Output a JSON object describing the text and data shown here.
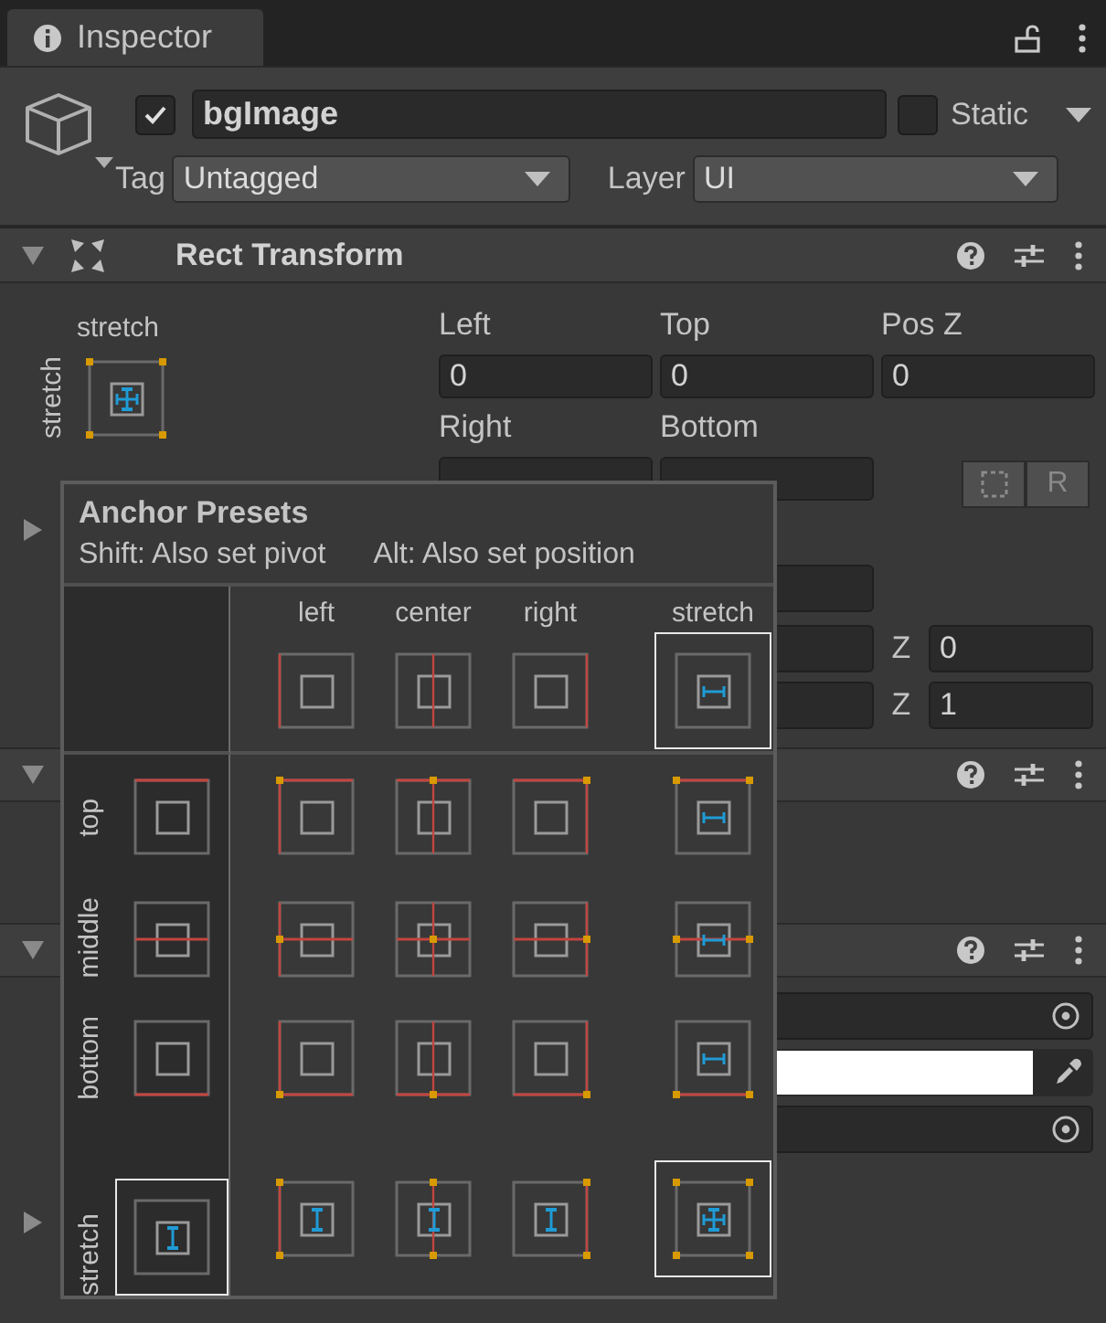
{
  "tab": {
    "title": "Inspector"
  },
  "game_object": {
    "active": true,
    "name": "bgImage",
    "static": false,
    "static_label": "Static",
    "tag_label": "Tag",
    "tag": "Untagged",
    "layer_label": "Layer",
    "layer": "UI"
  },
  "rect_transform": {
    "title": "Rect Transform",
    "expanded": true,
    "anchor": {
      "h_label": "stretch",
      "v_label": "stretch"
    },
    "fields": [
      {
        "label": "Left",
        "value": "0"
      },
      {
        "label": "Top",
        "value": "0"
      },
      {
        "label": "Pos Z",
        "value": "0"
      },
      {
        "label": "Right"
      },
      {
        "label": "Bottom"
      }
    ],
    "raw_button": "R",
    "anchors_expanded": false,
    "z_fields": [
      {
        "label": "Z",
        "value": "0"
      },
      {
        "label": "Z",
        "value": "1"
      }
    ]
  },
  "components": [
    {
      "expanded": true
    },
    {
      "expanded": true,
      "foldout_expanded": false,
      "fields": [
        {
          "kind": "object"
        },
        {
          "kind": "color",
          "color": "#ffffff"
        },
        {
          "kind": "object"
        }
      ]
    }
  ],
  "anchor_presets": {
    "title": "Anchor Presets",
    "shift_hint": "Shift: Also set pivot",
    "alt_hint": "Alt: Also set position",
    "columns": [
      {
        "label": "left",
        "selected": false
      },
      {
        "label": "center",
        "selected": false
      },
      {
        "label": "right",
        "selected": false
      },
      {
        "label": "stretch",
        "selected": true
      }
    ],
    "rows": [
      {
        "label": "top",
        "selected": false,
        "cells": [
          {
            "selected": false
          },
          {
            "selected": false
          },
          {
            "selected": false
          },
          {
            "selected": false
          }
        ]
      },
      {
        "label": "middle",
        "selected": false,
        "cells": [
          {
            "selected": false
          },
          {
            "selected": false
          },
          {
            "selected": false
          },
          {
            "selected": false
          }
        ]
      },
      {
        "label": "bottom",
        "selected": false,
        "cells": [
          {
            "selected": false
          },
          {
            "selected": false
          },
          {
            "selected": false
          },
          {
            "selected": false
          }
        ]
      },
      {
        "label": "stretch",
        "selected": true,
        "cells": [
          {
            "selected": false
          },
          {
            "selected": false
          },
          {
            "selected": false
          },
          {
            "selected": true
          }
        ]
      }
    ]
  }
}
